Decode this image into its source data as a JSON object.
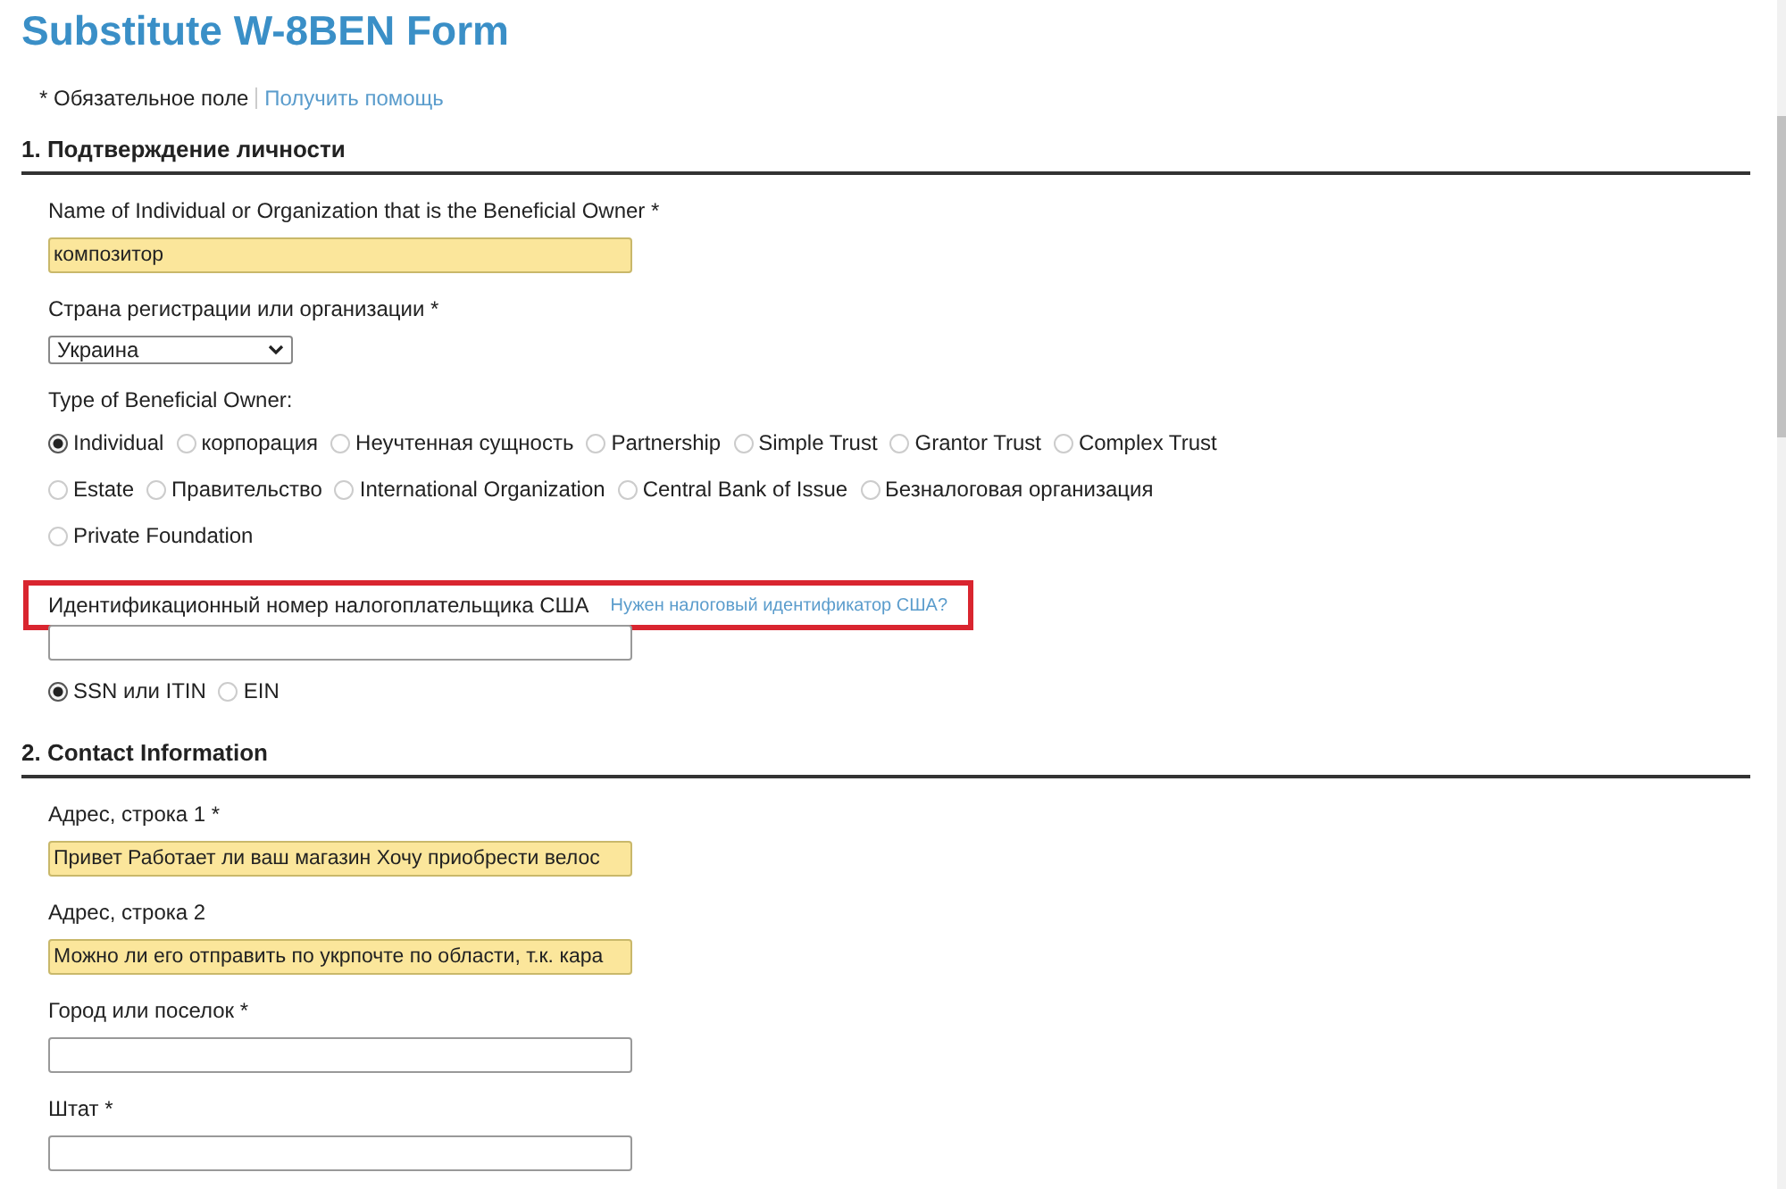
{
  "title": "Substitute W-8BEN Form",
  "required_note": "* Обязательное поле",
  "help_link": "Получить помощь",
  "sections": [
    {
      "heading": "1. Подтверждение личности",
      "items": [
        {
          "kind": "text",
          "label": "Name of Individual or Organization that is the Beneficial Owner *",
          "value": "композитор",
          "autofilled": true
        },
        {
          "kind": "select",
          "label": "Страна регистрации или организации *",
          "value": "Украина"
        },
        {
          "kind": "radio",
          "label": "Type of Beneficial Owner:",
          "options": [
            {
              "label": "Individual",
              "selected": true
            },
            {
              "label": "корпорация",
              "selected": false
            },
            {
              "label": "Неучтенная сущность",
              "selected": false
            },
            {
              "label": "Partnership",
              "selected": false
            },
            {
              "label": "Simple Trust",
              "selected": false
            },
            {
              "label": "Grantor Trust",
              "selected": false
            },
            {
              "label": "Complex Trust",
              "selected": false
            },
            {
              "label": "Estate",
              "selected": false
            },
            {
              "label": "Правительство",
              "selected": false
            },
            {
              "label": "International Organization",
              "selected": false
            },
            {
              "label": "Central Bank of Issue",
              "selected": false
            },
            {
              "label": "Безналоговая организация",
              "selected": false
            },
            {
              "label": "Private Foundation",
              "selected": false
            }
          ]
        },
        {
          "kind": "tin",
          "label": "Идентификационный номер налогоплательщика США",
          "link": "Нужен налоговый идентификатор США?",
          "highlighted": true,
          "options": [
            {
              "label": "SSN или ITIN",
              "selected": true
            },
            {
              "label": "EIN",
              "selected": false
            }
          ]
        }
      ]
    },
    {
      "heading": "2. Contact Information",
      "items": [
        {
          "kind": "text",
          "label": "Адрес, строка 1 *",
          "value": "Привет Работает ли ваш магазин Хочу приобрести велос",
          "autofilled": true
        },
        {
          "kind": "text",
          "label": "Адрес, строка 2",
          "value": "Можно ли его отправить по укрпочте по области, т.к. кара",
          "autofilled": true
        },
        {
          "kind": "text",
          "label": "Город или поселок *",
          "autofilled": false
        },
        {
          "kind": "text",
          "label": "Штат *",
          "autofilled": false
        }
      ]
    }
  ]
}
